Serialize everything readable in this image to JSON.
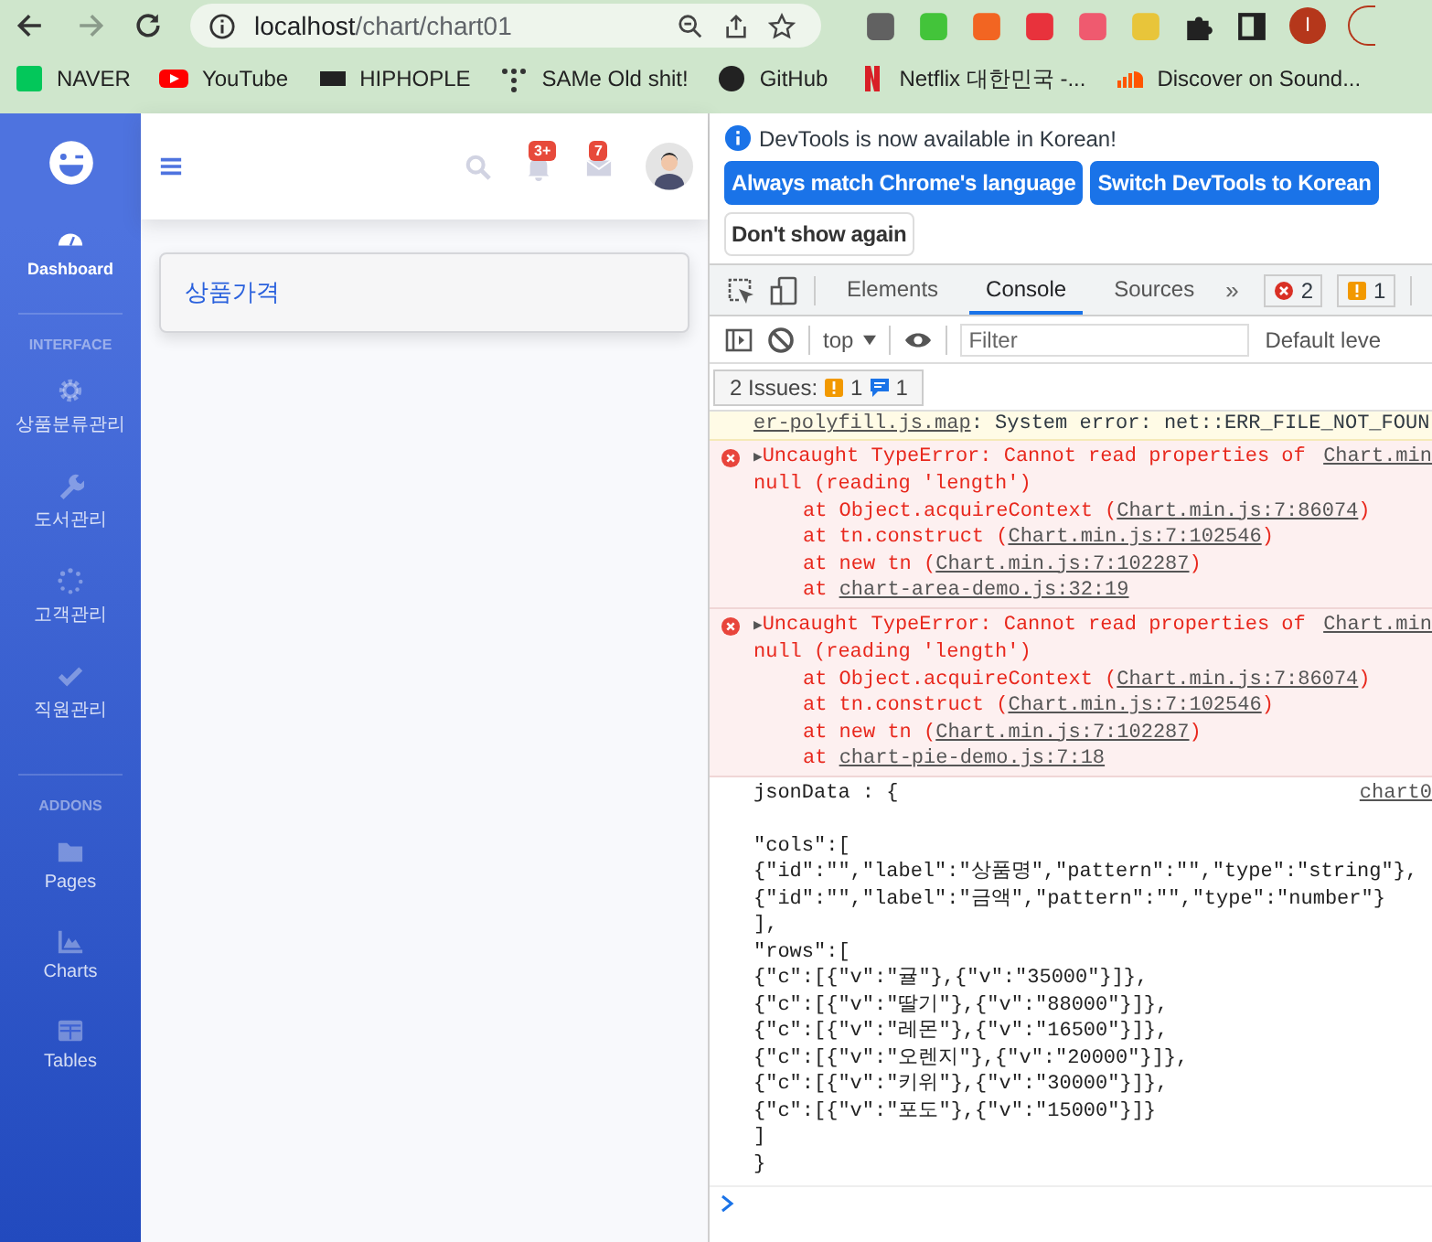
{
  "browser": {
    "url_host": "localhost",
    "url_path": "/chart/chart01",
    "profile_initial": "I",
    "extensions": [
      {
        "color": "#616161"
      },
      {
        "color": "#43c43a"
      },
      {
        "color": "#f26522"
      },
      {
        "color": "#e8323c"
      },
      {
        "color": "#ef5a6f"
      },
      {
        "color": "#e8c53a"
      }
    ]
  },
  "bookmarks": [
    {
      "label": "NAVER",
      "kind": "naver"
    },
    {
      "label": "YouTube",
      "kind": "youtube"
    },
    {
      "label": "HIPHOPLE",
      "kind": "hiphople"
    },
    {
      "label": "SAMe Old shit!",
      "kind": "dots"
    },
    {
      "label": "GitHub",
      "kind": "github"
    },
    {
      "label": "Netflix 대한민국 -...",
      "kind": "netflix"
    },
    {
      "label": "Discover on Sound...",
      "kind": "soundcloud"
    }
  ],
  "sidebar": [
    {
      "kind": "item",
      "label": "Dashboard",
      "selected": true
    },
    {
      "kind": "divider"
    },
    {
      "kind": "heading",
      "label": "INTERFACE"
    },
    {
      "kind": "item",
      "label": "상품분류관리",
      "selected": false
    },
    {
      "kind": "item",
      "label": "도서관리",
      "selected": false
    },
    {
      "kind": "item",
      "label": "고객관리",
      "selected": false
    },
    {
      "kind": "item",
      "label": "직원관리",
      "selected": false
    },
    {
      "kind": "divider"
    },
    {
      "kind": "heading",
      "label": "ADDONS"
    },
    {
      "kind": "item",
      "label": "Pages",
      "selected": false
    },
    {
      "kind": "item",
      "label": "Charts",
      "selected": false
    },
    {
      "kind": "item",
      "label": "Tables",
      "selected": false
    }
  ],
  "header": {
    "alerts_badge": "3+",
    "messages_badge": "7"
  },
  "card": {
    "title": "상품가격"
  },
  "devtools": {
    "infobar": {
      "message": "DevTools is now available in Korean!",
      "buttons": [
        {
          "label": "Always match Chrome's language",
          "kind": "primary"
        },
        {
          "label": "Switch DevTools to Korean",
          "kind": "primary"
        },
        {
          "label": "Don't show again",
          "kind": "secondary"
        }
      ]
    },
    "tabs": [
      {
        "label": "Elements",
        "selected": false
      },
      {
        "label": "Console",
        "selected": true
      },
      {
        "label": "Sources",
        "selected": false
      }
    ],
    "more": "»",
    "error_count": "2",
    "warning_count": "1",
    "context": "top",
    "filter_placeholder": "Filter",
    "levels": "Default leve",
    "issues": {
      "label": "2 Issues:",
      "warnings": "1",
      "info": "1"
    },
    "log": [
      {
        "kind": "warning",
        "link": "er-polyfill.js.map",
        "text": ": System error: net::ERR_FILE_NOT_FOUN"
      },
      {
        "kind": "error",
        "expander": "▶",
        "message": "Uncaught TypeError: Cannot read properties of null (reading 'length')",
        "source": "Chart.min",
        "frames": [
          {
            "prefix": "at Object.acquireContext (",
            "link": "Chart.min.js:7:86074",
            "suffix": ")"
          },
          {
            "prefix": "at tn.construct (",
            "link": "Chart.min.js:7:102546",
            "suffix": ")"
          },
          {
            "prefix": "at new tn (",
            "link": "Chart.min.js:7:102287",
            "suffix": ")"
          },
          {
            "prefix": "at ",
            "link": "chart-area-demo.js:32:19"
          }
        ]
      },
      {
        "kind": "error",
        "expander": "▶",
        "message": "Uncaught TypeError: Cannot read properties of null (reading 'length')",
        "source": "Chart.min",
        "frames": [
          {
            "prefix": "at Object.acquireContext (",
            "link": "Chart.min.js:7:86074",
            "suffix": ")"
          },
          {
            "prefix": "at tn.construct (",
            "link": "Chart.min.js:7:102546",
            "suffix": ")"
          },
          {
            "prefix": "at new tn (",
            "link": "Chart.min.js:7:102287",
            "suffix": ")"
          },
          {
            "prefix": "at ",
            "link": "chart-pie-demo.js:7:18"
          }
        ]
      },
      {
        "kind": "log",
        "head": "jsonData : {",
        "source": "chart0",
        "lines": [
          "\"cols\":[",
          "{\"id\":\"\",\"label\":\"상품명\",\"pattern\":\"\",\"type\":\"string\"},",
          "{\"id\":\"\",\"label\":\"금액\",\"pattern\":\"\",\"type\":\"number\"}",
          "],",
          "\"rows\":[",
          "{\"c\":[{\"v\":\"귤\"},{\"v\":\"35000\"}]},",
          "{\"c\":[{\"v\":\"딸기\"},{\"v\":\"88000\"}]},",
          "{\"c\":[{\"v\":\"레몬\"},{\"v\":\"16500\"}]},",
          "{\"c\":[{\"v\":\"오렌지\"},{\"v\":\"20000\"}]},",
          "{\"c\":[{\"v\":\"키위\"},{\"v\":\"30000\"}]},",
          "{\"c\":[{\"v\":\"포도\"},{\"v\":\"15000\"}]}",
          "]",
          "}"
        ]
      }
    ]
  }
}
